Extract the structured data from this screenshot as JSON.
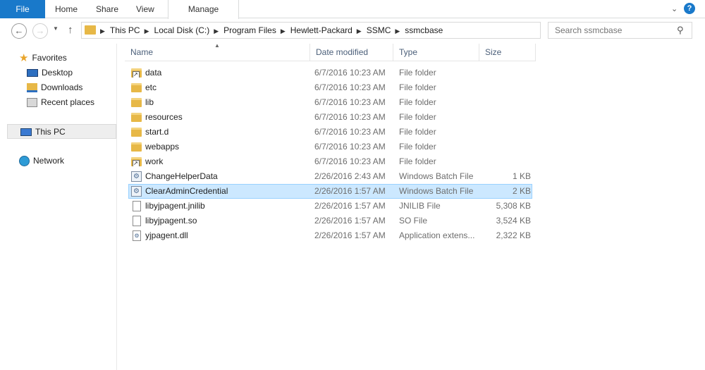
{
  "ribbon": {
    "tabs": [
      "File",
      "Home",
      "Share",
      "View",
      "Manage"
    ]
  },
  "nav": {
    "back_icon": "back-arrow-icon",
    "forward_icon": "forward-arrow-icon",
    "up_icon": "up-arrow-icon"
  },
  "address": {
    "crumbs": [
      "This PC",
      "Local Disk (C:)",
      "Program Files",
      "Hewlett-Packard",
      "SSMC",
      "ssmcbase"
    ]
  },
  "search": {
    "placeholder": "Search ssmcbase"
  },
  "sidebar": {
    "favorites": "Favorites",
    "desktop": "Desktop",
    "downloads": "Downloads",
    "recent": "Recent places",
    "thispc": "This PC",
    "network": "Network"
  },
  "columns": {
    "name": "Name",
    "date": "Date modified",
    "type": "Type",
    "size": "Size"
  },
  "files": [
    {
      "name": "data",
      "date": "6/7/2016 10:23 AM",
      "type": "File folder",
      "size": "",
      "icon": "folder-shortcut-icon"
    },
    {
      "name": "etc",
      "date": "6/7/2016 10:23 AM",
      "type": "File folder",
      "size": "",
      "icon": "folder-icon"
    },
    {
      "name": "lib",
      "date": "6/7/2016 10:23 AM",
      "type": "File folder",
      "size": "",
      "icon": "folder-icon"
    },
    {
      "name": "resources",
      "date": "6/7/2016 10:23 AM",
      "type": "File folder",
      "size": "",
      "icon": "folder-icon"
    },
    {
      "name": "start.d",
      "date": "6/7/2016 10:23 AM",
      "type": "File folder",
      "size": "",
      "icon": "folder-icon"
    },
    {
      "name": "webapps",
      "date": "6/7/2016 10:23 AM",
      "type": "File folder",
      "size": "",
      "icon": "folder-icon"
    },
    {
      "name": "work",
      "date": "6/7/2016 10:23 AM",
      "type": "File folder",
      "size": "",
      "icon": "folder-shortcut-icon"
    },
    {
      "name": "ChangeHelperData",
      "date": "2/26/2016 2:43 AM",
      "type": "Windows Batch File",
      "size": "1 KB",
      "icon": "batch-file-icon"
    },
    {
      "name": "ClearAdminCredential",
      "date": "2/26/2016 1:57 AM",
      "type": "Windows Batch File",
      "size": "2 KB",
      "icon": "batch-file-icon",
      "selected": true
    },
    {
      "name": "libyjpagent.jnilib",
      "date": "2/26/2016 1:57 AM",
      "type": "JNILIB File",
      "size": "5,308 KB",
      "icon": "file-icon"
    },
    {
      "name": "libyjpagent.so",
      "date": "2/26/2016 1:57 AM",
      "type": "SO File",
      "size": "3,524 KB",
      "icon": "file-icon"
    },
    {
      "name": "yjpagent.dll",
      "date": "2/26/2016 1:57 AM",
      "type": "Application extens...",
      "size": "2,322 KB",
      "icon": "dll-file-icon"
    }
  ]
}
